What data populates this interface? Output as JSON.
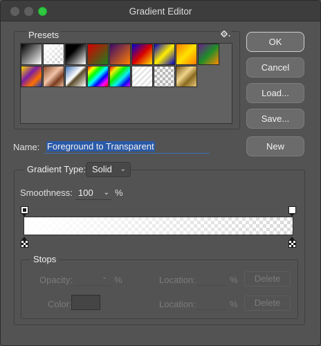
{
  "window": {
    "title": "Gradient Editor"
  },
  "presets": {
    "label": "Presets",
    "menu_icon": "gear-icon",
    "swatches": [
      {
        "name": "foreground-to-background",
        "bg": "linear-gradient(135deg,#000 0%,#fff 100%)"
      },
      {
        "name": "foreground-to-transparent",
        "bg": "linear-gradient(135deg,#fff 0%,rgba(255,255,255,0) 100%), repeating-conic-gradient(#ccc 0% 25%,#fff 0% 50%) 0 0/8px 8px"
      },
      {
        "name": "black-white",
        "bg": "linear-gradient(135deg,#000 0%,#000 35%,#fff 100%)"
      },
      {
        "name": "red-green",
        "bg": "linear-gradient(135deg,#d60000 0%,#1e7f1e 100%)"
      },
      {
        "name": "violet-orange",
        "bg": "linear-gradient(135deg,#3b0a6b 0%,#ff7f00 100%)"
      },
      {
        "name": "blue-red-yellow",
        "bg": "linear-gradient(135deg,#0000d8 0%,#d80000 50%,#ffe400 100%)"
      },
      {
        "name": "blue-yellow-blue",
        "bg": "linear-gradient(135deg,#0000c8 0%,#ffee00 50%,#0000c8 100%)"
      },
      {
        "name": "orange-yellow-orange",
        "bg": "linear-gradient(135deg,#ff7a00 0%,#ffe200 50%,#ff7a00 100%)"
      },
      {
        "name": "violet-green-orange",
        "bg": "linear-gradient(135deg,#6a1d8c 0%,#1f8c2a 50%,#ff8a00 100%)"
      },
      {
        "name": "yellow-violet-orange-blue",
        "bg": "linear-gradient(135deg,#ffd800 0%,#7b1fa2 40%,#ff6f00 70%,#1a3dbf 100%)"
      },
      {
        "name": "copper",
        "bg": "linear-gradient(135deg,#8a4b2a 0%,#f2c3a8 45%,#7a3b1e 70%,#e6b89a 100%)"
      },
      {
        "name": "chrome",
        "bg": "linear-gradient(135deg,#3f6fb5 0%,#ffffff 45%,#5a4a2a 55%,#ffffff 100%)"
      },
      {
        "name": "spectrum",
        "bg": "linear-gradient(135deg,#ff0000,#ffff00,#00ff00,#00ffff,#0000ff,#ff00ff,#ff0000)"
      },
      {
        "name": "transparent-rainbow",
        "bg": "linear-gradient(135deg,rgba(255,0,0,.9),rgba(255,255,0,.9),rgba(0,255,0,.9),rgba(0,255,255,.9),rgba(0,0,255,.9),rgba(255,0,255,.9))"
      },
      {
        "name": "transparent-stripes",
        "bg": "repeating-linear-gradient(135deg,#ffffff 0 3px,#e6e6e6 3px 6px)"
      },
      {
        "name": "transparent-checker",
        "bg": "repeating-conic-gradient(#b8b8b8 0% 25%,#f2f2f2 0% 50%) 0 0/8px 8px"
      },
      {
        "name": "gold",
        "bg": "linear-gradient(135deg,#7a5a1a 0%,#f0d48a 40%,#8a6a20 65%,#e8c878 100%)"
      }
    ]
  },
  "buttons": {
    "ok": "OK",
    "cancel": "Cancel",
    "load": "Load...",
    "save": "Save...",
    "new": "New"
  },
  "name": {
    "label": "Name:",
    "value": "Foreground to Transparent"
  },
  "gradient": {
    "type_label": "Gradient Type:",
    "type_value": "Solid",
    "smoothness_label": "Smoothness:",
    "smoothness_value": "100",
    "smoothness_unit": "%"
  },
  "stops": {
    "label": "Stops",
    "opacity_label": "Opacity:",
    "opacity_unit": "%",
    "color_label": "Color:",
    "location_label": "Location:",
    "location_unit": "%",
    "delete_label": "Delete"
  }
}
